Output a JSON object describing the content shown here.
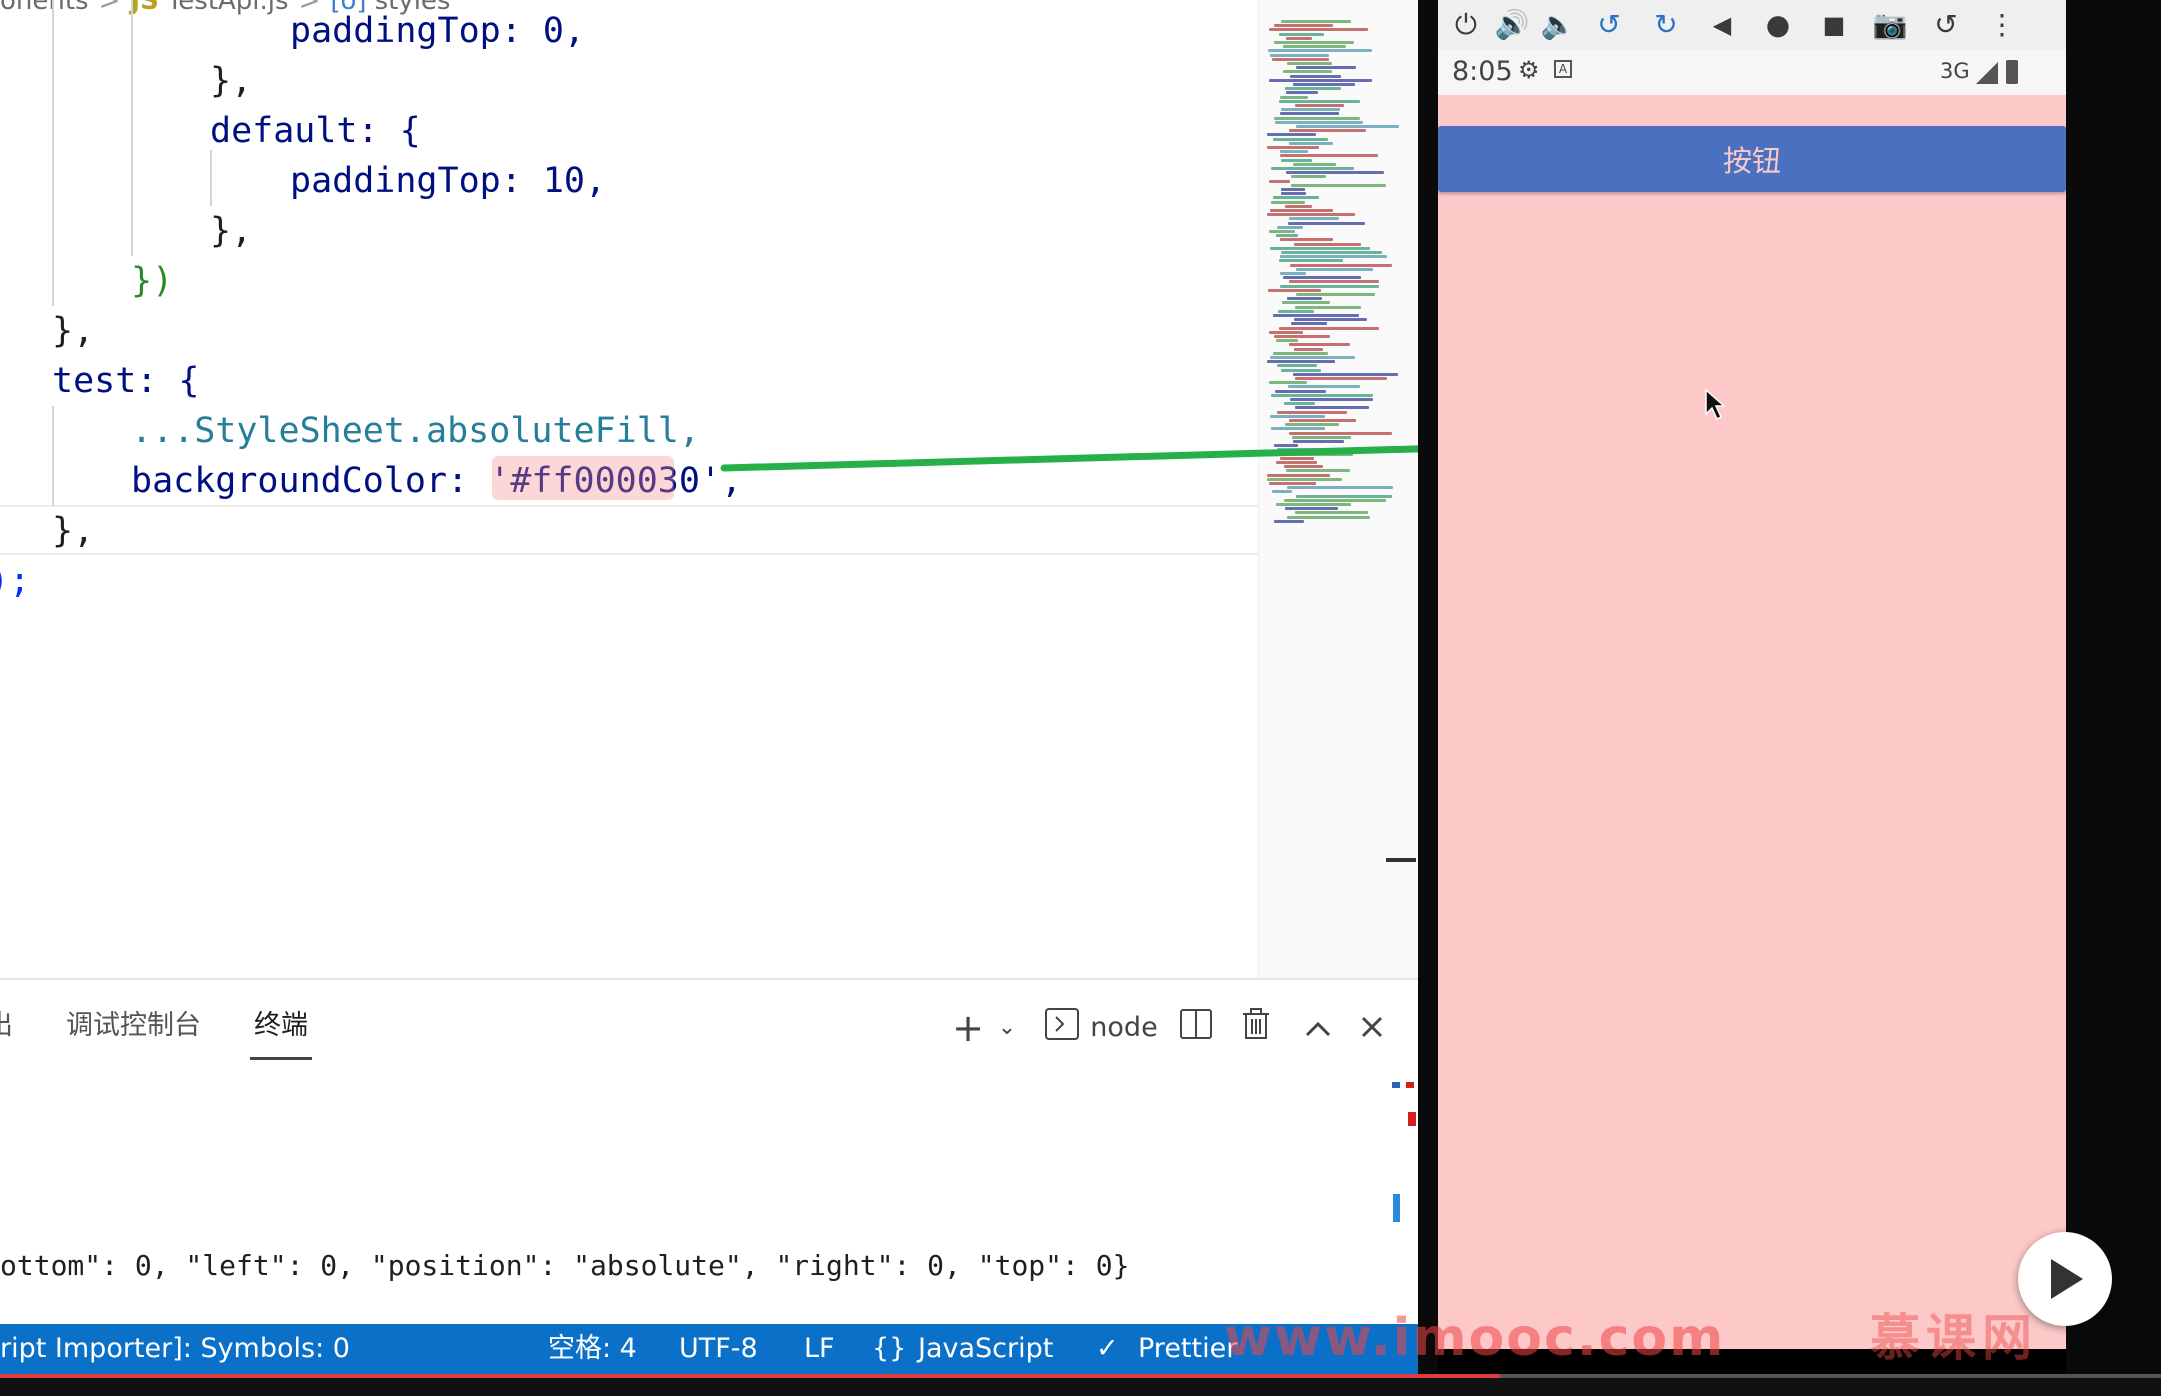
{
  "editor": {
    "breadcrumb": {
      "folder": "onents",
      "file_icon": "JS",
      "file": "TestApi.js",
      "symbol_icon": "[o]",
      "symbol": "styles"
    },
    "lines": [
      "paddingTop: 0,",
      "},",
      "default: {",
      "paddingTop: 10,",
      "},",
      "})",
      "},",
      "test: {",
      "...StyleSheet.absoluteFill,",
      "backgroundColor: '#ff000030',",
      "},",
      ");"
    ],
    "highlighted_value": "#ff000030"
  },
  "panel": {
    "tabs": [
      "出",
      "调试控制台",
      "终端"
    ],
    "active_tab": "终端",
    "terminal_type": "node",
    "terminal_output": "ottom\": 0, \"left\": 0, \"position\": \"absolute\", \"right\": 0, \"top\": 0}",
    "icons": [
      "plus-icon",
      "chevron-down-icon",
      "terminal-icon",
      "split-icon",
      "trash-icon",
      "chevron-up-icon",
      "close-icon"
    ]
  },
  "statusbar": {
    "importer": "ript Importer]: Symbols: 0",
    "spaces": "空格: 4",
    "encoding": "UTF-8",
    "eol": "LF",
    "language": "JavaScript",
    "language_icon": "{}",
    "prettier": "Prettier",
    "colors": {
      "background": "#0b70c8"
    }
  },
  "emulator": {
    "toolbar_icons": [
      "power-icon",
      "volume-up-icon",
      "volume-down-icon",
      "rotate-left-icon",
      "rotate-right-icon",
      "back-icon",
      "home-icon",
      "overview-icon",
      "camera-icon",
      "replay-icon",
      "more-icon"
    ],
    "status_time": "8:05",
    "network": "3G",
    "button_label": "按钮",
    "screen_color": "#fcc8c8",
    "button_color": "#4a70c0"
  },
  "watermark": {
    "text": "www.imooc.com",
    "brand": "慕课网"
  }
}
